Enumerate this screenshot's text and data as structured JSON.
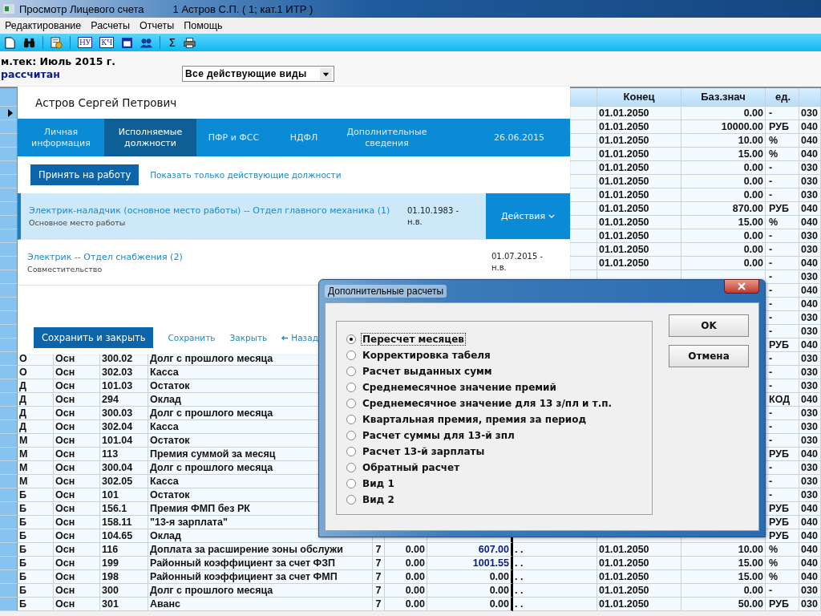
{
  "window": {
    "title": "Просмотр Лицевого счета",
    "subtitle": "1 Астров С.П. ( 1; кат.1 ИТР )"
  },
  "menu": [
    "Редактирование",
    "Расчеты",
    "Отчеты",
    "Помощь"
  ],
  "toolbar_labels": [
    "НУ",
    "КЧ",
    "Σ"
  ],
  "period": "м.тек: Июль 2015 г.",
  "status": "рассчитан",
  "filter": {
    "value": "Все действующие виды"
  },
  "table": {
    "headers": {
      "column_9": "Конец",
      "column_10": "Баз.знач",
      "column_11": "ед."
    },
    "rows": [
      {
        "selected": true,
        "cells": {
          "column_9": "01.01.2050",
          "column_10": "0.00",
          "column_11": "-",
          "column_12": "030"
        }
      },
      {
        "selected": false,
        "cells": {
          "column_9": "01.01.2050",
          "column_10": "10000.00",
          "column_11": "РУБ",
          "column_12": "040"
        }
      },
      {
        "selected": false,
        "cells": {
          "column_9": "01.01.2050",
          "column_10": "10.00",
          "column_11": "%",
          "column_12": "040"
        }
      },
      {
        "selected": false,
        "cells": {
          "column_9": "01.01.2050",
          "column_10": "15.00",
          "column_11": "%",
          "column_12": "040"
        }
      },
      {
        "selected": false,
        "cells": {
          "column_9": "01.01.2050",
          "column_10": "0.00",
          "column_11": "-",
          "column_12": "030"
        }
      },
      {
        "selected": false,
        "cells": {
          "column_9": "01.01.2050",
          "column_10": "0.00",
          "column_11": "-",
          "column_12": "030"
        }
      },
      {
        "selected": false,
        "cells": {
          "column_9": "01.01.2050",
          "column_10": "0.00",
          "column_11": "-",
          "column_12": "030"
        }
      },
      {
        "selected": false,
        "cells": {
          "column_9": "01.01.2050",
          "column_10": "870.00",
          "column_11": "РУБ",
          "column_12": "040"
        }
      },
      {
        "selected": false,
        "cells": {
          "column_9": "01.01.2050",
          "column_10": "15.00",
          "column_11": "%",
          "column_12": "040"
        }
      },
      {
        "selected": false,
        "cells": {
          "column_9": "01.01.2050",
          "column_10": "0.00",
          "column_11": "-",
          "column_12": "030"
        }
      },
      {
        "selected": false,
        "cells": {
          "column_9": "01.01.2050",
          "column_10": "0.00",
          "column_11": "-",
          "column_12": "030"
        }
      },
      {
        "selected": false,
        "cells": {
          "column_9": "01.01.2050",
          "column_10": "0.00",
          "column_11": "-",
          "column_12": "040"
        }
      },
      {
        "selected": false,
        "cells": {
          "column_11": "-",
          "column_12": "030"
        }
      },
      {
        "selected": false,
        "cells": {
          "column_11": "-",
          "column_12": "040"
        }
      },
      {
        "selected": false,
        "cells": {
          "column_11": "-",
          "column_12": "040"
        }
      },
      {
        "selected": false,
        "cells": {
          "column_11": "-",
          "column_12": "030"
        }
      },
      {
        "selected": false,
        "cells": {
          "column_11": "-",
          "column_12": "030"
        }
      },
      {
        "selected": false,
        "cells": {
          "column_11": "РУБ",
          "column_12": "040"
        }
      },
      {
        "selected": false,
        "cells": {
          "column_1": "О",
          "column_2": "Осн",
          "column_3": "300.02",
          "column_4": "Долг с прошлого месяца",
          "column_11": "-",
          "column_12": "030"
        }
      },
      {
        "selected": false,
        "cells": {
          "column_1": "О",
          "column_2": "Осн",
          "column_3": "302.03",
          "column_4": "Касса",
          "column_11": "-",
          "column_12": "030"
        }
      },
      {
        "selected": false,
        "cells": {
          "column_1": "Д",
          "column_2": "Осн",
          "column_3": "101.03",
          "column_4": "Остаток",
          "column_11": "-",
          "column_12": "030"
        }
      },
      {
        "selected": false,
        "cells": {
          "column_1": "Д",
          "column_2": "Осн",
          "column_3": "294",
          "column_4": "Оклад",
          "column_11": "КОД",
          "column_12": "040"
        }
      },
      {
        "selected": false,
        "cells": {
          "column_1": "Д",
          "column_2": "Осн",
          "column_3": "300.03",
          "column_4": "Долг с прошлого месяца",
          "column_11": "-",
          "column_12": "030"
        }
      },
      {
        "selected": false,
        "cells": {
          "column_1": "Д",
          "column_2": "Осн",
          "column_3": "302.04",
          "column_4": "Касса",
          "column_11": "-",
          "column_12": "030"
        }
      },
      {
        "selected": false,
        "cells": {
          "column_1": "М",
          "column_2": "Осн",
          "column_3": "101.04",
          "column_4": "Остаток",
          "column_11": "-",
          "column_12": "030"
        }
      },
      {
        "selected": false,
        "cells": {
          "column_1": "М",
          "column_2": "Осн",
          "column_3": "113",
          "column_4": "Премия суммой за месяц",
          "column_11": "РУБ",
          "column_12": "040"
        }
      },
      {
        "selected": false,
        "cells": {
          "column_1": "М",
          "column_2": "Осн",
          "column_3": "300.04",
          "column_4": "Долг с прошлого месяца",
          "column_11": "-",
          "column_12": "030"
        }
      },
      {
        "selected": false,
        "cells": {
          "column_1": "М",
          "column_2": "Осн",
          "column_3": "302.05",
          "column_4": "Касса",
          "column_11": "-",
          "column_12": "030"
        }
      },
      {
        "selected": false,
        "cells": {
          "column_1": "Б",
          "column_2": "Осн",
          "column_3": "101",
          "column_4": "Остаток",
          "column_11": "-",
          "column_12": "030"
        }
      },
      {
        "selected": false,
        "cells": {
          "column_1": "Б",
          "column_2": "Осн",
          "column_3": "156.1",
          "column_4": "Премия ФМП без РК",
          "column_11": "РУБ",
          "column_12": "040"
        }
      },
      {
        "selected": false,
        "cells": {
          "column_1": "Б",
          "column_2": "Осн",
          "column_3": "158.11",
          "column_4": "\"13-я зарплата\"",
          "column_11": "РУБ",
          "column_12": "040"
        }
      },
      {
        "selected": false,
        "cells": {
          "column_1": "Б",
          "column_2": "Осн",
          "column_3": "104.65",
          "column_4": "Оклад",
          "column_11": "РУБ",
          "column_12": "040"
        }
      },
      {
        "selected": false,
        "highlighted": true,
        "cells": {
          "column_1": "Б",
          "column_2": "Осн",
          "column_3": "116",
          "column_4": "Доплата за расширение зоны обслужи",
          "column_5": "7",
          "column_6": "0.00",
          "column_7": "607.00",
          "column_8": ". .",
          "column_9": "01.01.2050",
          "column_10": "10.00",
          "column_11": "%",
          "column_12": "040"
        }
      },
      {
        "selected": false,
        "highlighted": true,
        "cells": {
          "column_1": "Б",
          "column_2": "Осн",
          "column_3": "199",
          "column_4": "Районный коэффициент за счет ФЗП",
          "column_5": "7",
          "column_6": "0.00",
          "column_7": "1001.55",
          "column_8": ". .",
          "column_9": "01.01.2050",
          "column_10": "15.00",
          "column_11": "%",
          "column_12": "040"
        }
      },
      {
        "selected": false,
        "highlighted": false,
        "cells": {
          "column_1": "Б",
          "column_2": "Осн",
          "column_3": "198",
          "column_4": "Районный коэффициент за счет ФМП",
          "column_5": "7",
          "column_6": "0.00",
          "column_7": "0.00",
          "column_8": ". .",
          "column_9": "01.01.2050",
          "column_10": "15.00",
          "column_11": "%",
          "column_12": "040"
        }
      },
      {
        "selected": false,
        "highlighted": false,
        "cells": {
          "column_1": "Б",
          "column_2": "Осн",
          "column_3": "300",
          "column_4": "Долг с прошлого месяца",
          "column_5": "7",
          "column_6": "0.00",
          "column_7": "0.00",
          "column_8": ". .",
          "column_9": "01.01.2050",
          "column_10": "0.00",
          "column_11": "-",
          "column_12": "030"
        }
      },
      {
        "selected": false,
        "highlighted": false,
        "cells": {
          "column_1": "Б",
          "column_2": "Осн",
          "column_3": "301",
          "column_4": "Аванс",
          "column_5": "7",
          "column_6": "0.00",
          "column_7": "0.00",
          "column_8": ". .",
          "column_9": "01.01.2050",
          "column_10": "50.00",
          "column_11": "РУБ",
          "column_12": "030"
        }
      }
    ]
  },
  "employee_card": {
    "name": "Астров Сергей Петрович",
    "tabs": [
      {
        "label": "Личная информация",
        "selected": false
      },
      {
        "label": "Исполняемые должности",
        "selected": true
      },
      {
        "label": "ПФР и ФСС",
        "selected": false
      },
      {
        "label": "НДФЛ",
        "selected": false
      },
      {
        "label": "Дополнительные сведения",
        "selected": false
      }
    ],
    "date": "26.06.2015",
    "hire_button": "Принять на работу",
    "filter_link": "Показать только действующие должности",
    "positions": [
      {
        "title": "Электрик-наладчик (основное место работы) -- Отдел главного механика (1)",
        "subtitle": "Основное место работы",
        "start": "01.10.1983 -",
        "end": "н.в.",
        "selected": true,
        "action": "Действия"
      },
      {
        "title": "Электрик -- Отдел снабжения (2)",
        "subtitle": "Совместительство",
        "start": "01.07.2015 -",
        "end": "н.в.",
        "selected": false
      }
    ],
    "footer": {
      "primary": "Сохранить и закрыть",
      "links": [
        "Сохранить",
        "Закрыть"
      ],
      "back": "Назад"
    }
  },
  "dialog": {
    "title": "Дополнительные расчеты",
    "options": [
      {
        "label": "Пересчет месяцев",
        "selected": true
      },
      {
        "label": "Корректировка табеля",
        "selected": false
      },
      {
        "label": "Расчет выданных сумм",
        "selected": false
      },
      {
        "label": "Среднемесячное значение премий",
        "selected": false
      },
      {
        "label": "Среднемесячное значение для 13 з/пл и т.п.",
        "selected": false
      },
      {
        "label": "Квартальная премия, премия за период",
        "selected": false
      },
      {
        "label": "Расчет суммы для 13-й зпл",
        "selected": false
      },
      {
        "label": "Расчет 13-й зарплаты",
        "selected": false
      },
      {
        "label": "Обратный расчет",
        "selected": false
      },
      {
        "label": "Вид 1",
        "selected": false
      },
      {
        "label": "Вид 2",
        "selected": false
      }
    ],
    "buttons": [
      "OK",
      "Отмена"
    ]
  }
}
